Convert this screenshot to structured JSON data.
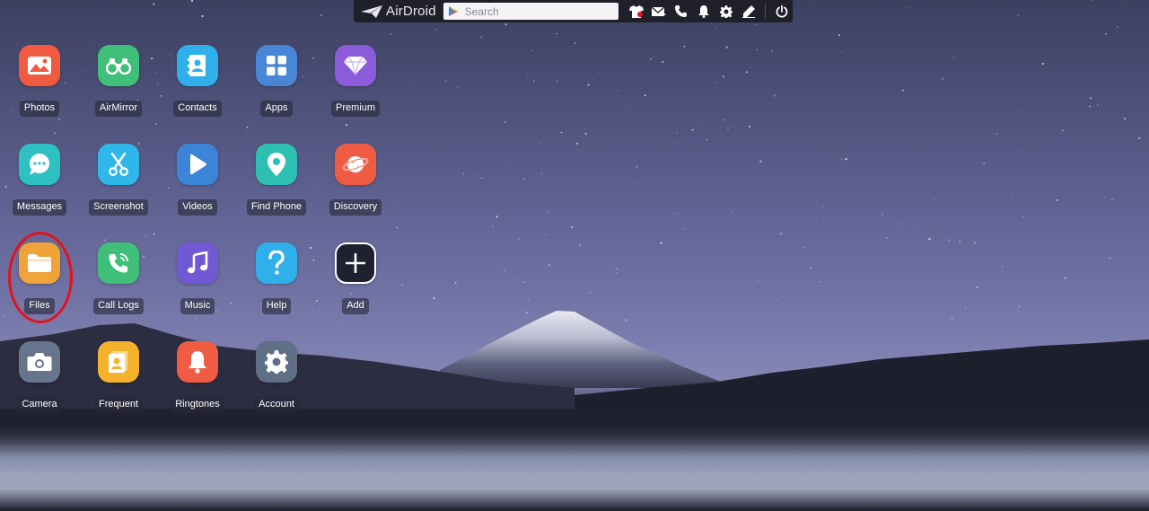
{
  "toolbar": {
    "logo_text": "AirDroid",
    "search_placeholder": "Search",
    "icons": [
      "tshirt-icon",
      "mail-icon",
      "phone-icon",
      "bell-icon",
      "gear-icon",
      "edit-icon",
      "power-icon"
    ]
  },
  "apps": [
    {
      "label": "Photos",
      "color": "#ef5a40"
    },
    {
      "label": "AirMirror",
      "color": "#3fbf79"
    },
    {
      "label": "Contacts",
      "color": "#2fb0ea"
    },
    {
      "label": "Apps",
      "color": "#4a86d6"
    },
    {
      "label": "Premium",
      "color": "#8b5bd9"
    },
    {
      "label": "Messages",
      "color": "#2ec0c3"
    },
    {
      "label": "Screenshot",
      "color": "#2fb7ea"
    },
    {
      "label": "Videos",
      "color": "#3c84d8"
    },
    {
      "label": "Find Phone",
      "color": "#2dbfb2"
    },
    {
      "label": "Discovery",
      "color": "#ef5b43"
    },
    {
      "label": "Files",
      "color": "#f0a338"
    },
    {
      "label": "Call Logs",
      "color": "#3fbf79"
    },
    {
      "label": "Music",
      "color": "#7159d6"
    },
    {
      "label": "Help",
      "color": "#2fb0ea"
    },
    {
      "label": "Add",
      "color": "#1f2130"
    },
    {
      "label": "Camera",
      "color": "#66758c"
    },
    {
      "label": "Frequent",
      "color": "#f4b22c"
    },
    {
      "label": "Ringtones",
      "color": "#ef5b43"
    },
    {
      "label": "Account",
      "color": "#5f6f86"
    }
  ],
  "highlight_color": "#e3121c"
}
